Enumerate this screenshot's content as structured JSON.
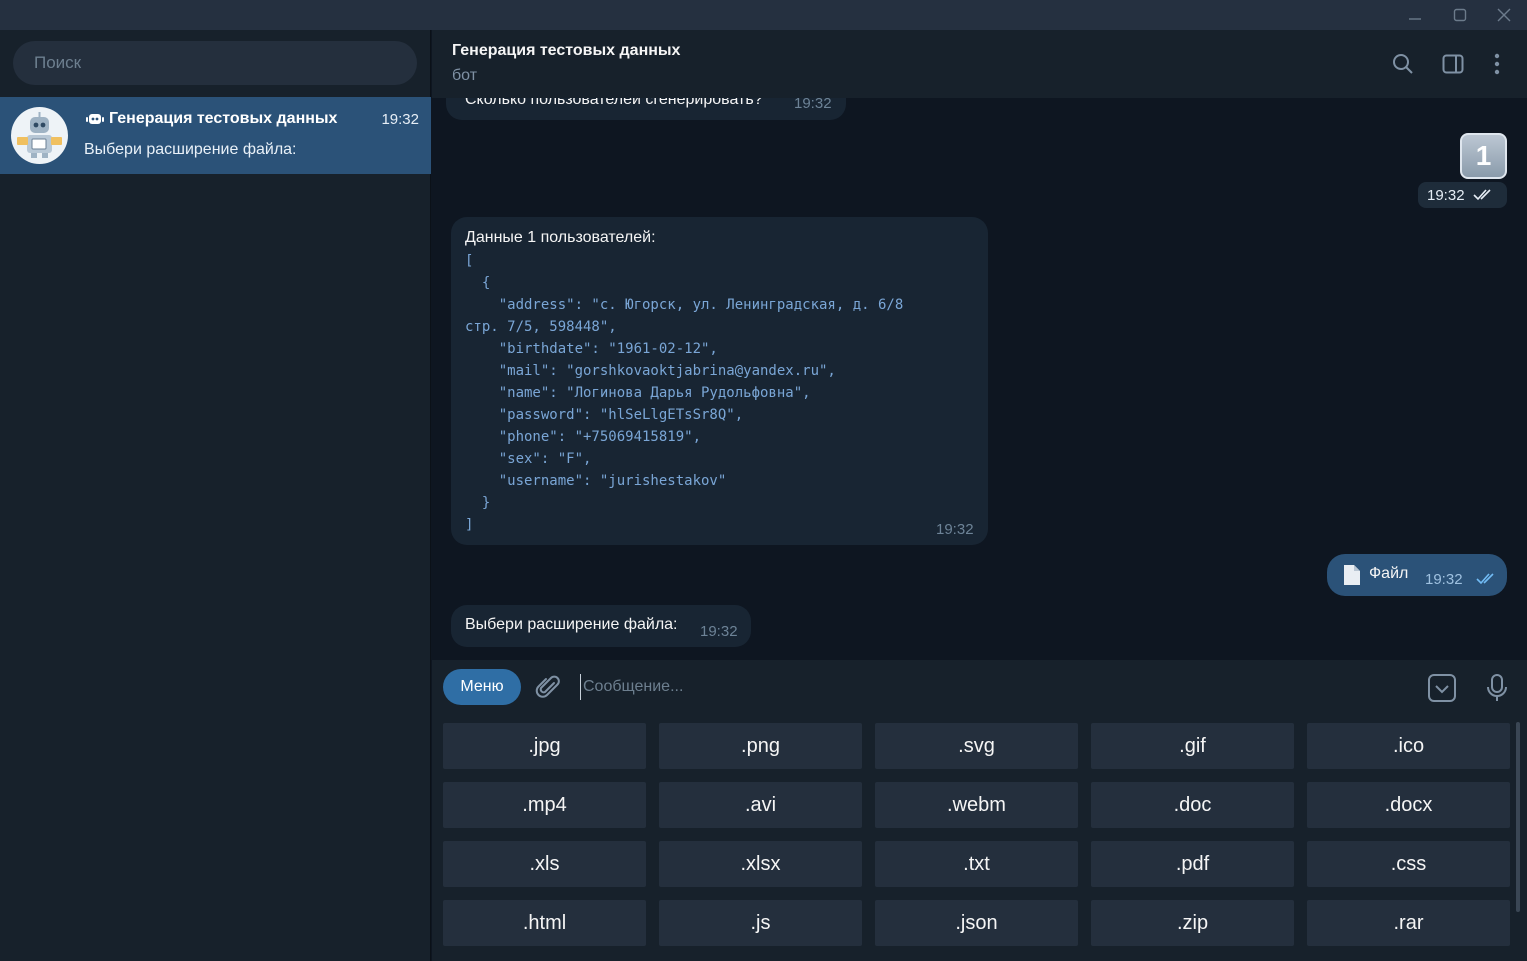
{
  "search": {
    "placeholder": "Поиск"
  },
  "chat_list": [
    {
      "title": "Генерация тестовых данных",
      "time": "19:32",
      "preview": "Выбери расширение файла:"
    }
  ],
  "header": {
    "title": "Генерация тестовых данных",
    "subtitle": "бот"
  },
  "messages": {
    "m1": {
      "text": "Сколько пользователей сгенерировать?",
      "time": "19:32"
    },
    "m2": {
      "text": "1",
      "time": "19:32"
    },
    "m3": {
      "heading": "Данные 1 пользователей:",
      "code": "[\n  {\n    \"address\": \"с. Югорск, ул. Ленинградская, д. 6/8\nстр. 7/5, 598448\",\n    \"birthdate\": \"1961-02-12\",\n    \"mail\": \"gorshkovaoktjabrina@yandex.ru\",\n    \"name\": \"Логинова Дарья Рудольфовна\",\n    \"password\": \"hlSeLlgETsSr8Q\",\n    \"phone\": \"+75069415819\",\n    \"sex\": \"F\",\n    \"username\": \"jurishestakov\"\n  }\n]",
      "time": "19:32"
    },
    "m4": {
      "text": "Файл",
      "time": "19:32"
    },
    "m5": {
      "text": "Выбери расширение файла:",
      "time": "19:32"
    }
  },
  "composer": {
    "menu_label": "Меню",
    "placeholder": "Сообщение..."
  },
  "keyboard": [
    [
      ".jpg",
      ".png",
      ".svg",
      ".gif",
      ".ico"
    ],
    [
      ".mp4",
      ".avi",
      ".webm",
      ".doc",
      ".docx"
    ],
    [
      ".xls",
      ".xlsx",
      ".txt",
      ".pdf",
      ".css"
    ],
    [
      ".html",
      ".js",
      ".json",
      ".zip",
      ".rar"
    ]
  ],
  "colors": {
    "background": "#0e1621",
    "panel": "#17212b",
    "accent": "#2b5278",
    "incoming_bubble": "#182533",
    "keyboard_button": "#242f3d"
  },
  "icons": [
    "minimize-icon",
    "maximize-icon",
    "close-icon",
    "search-icon",
    "sidebar-toggle-icon",
    "more-icon",
    "bot-icon",
    "paperclip-icon",
    "emoji-icon",
    "microphone-icon",
    "file-icon",
    "double-check-icon"
  ]
}
